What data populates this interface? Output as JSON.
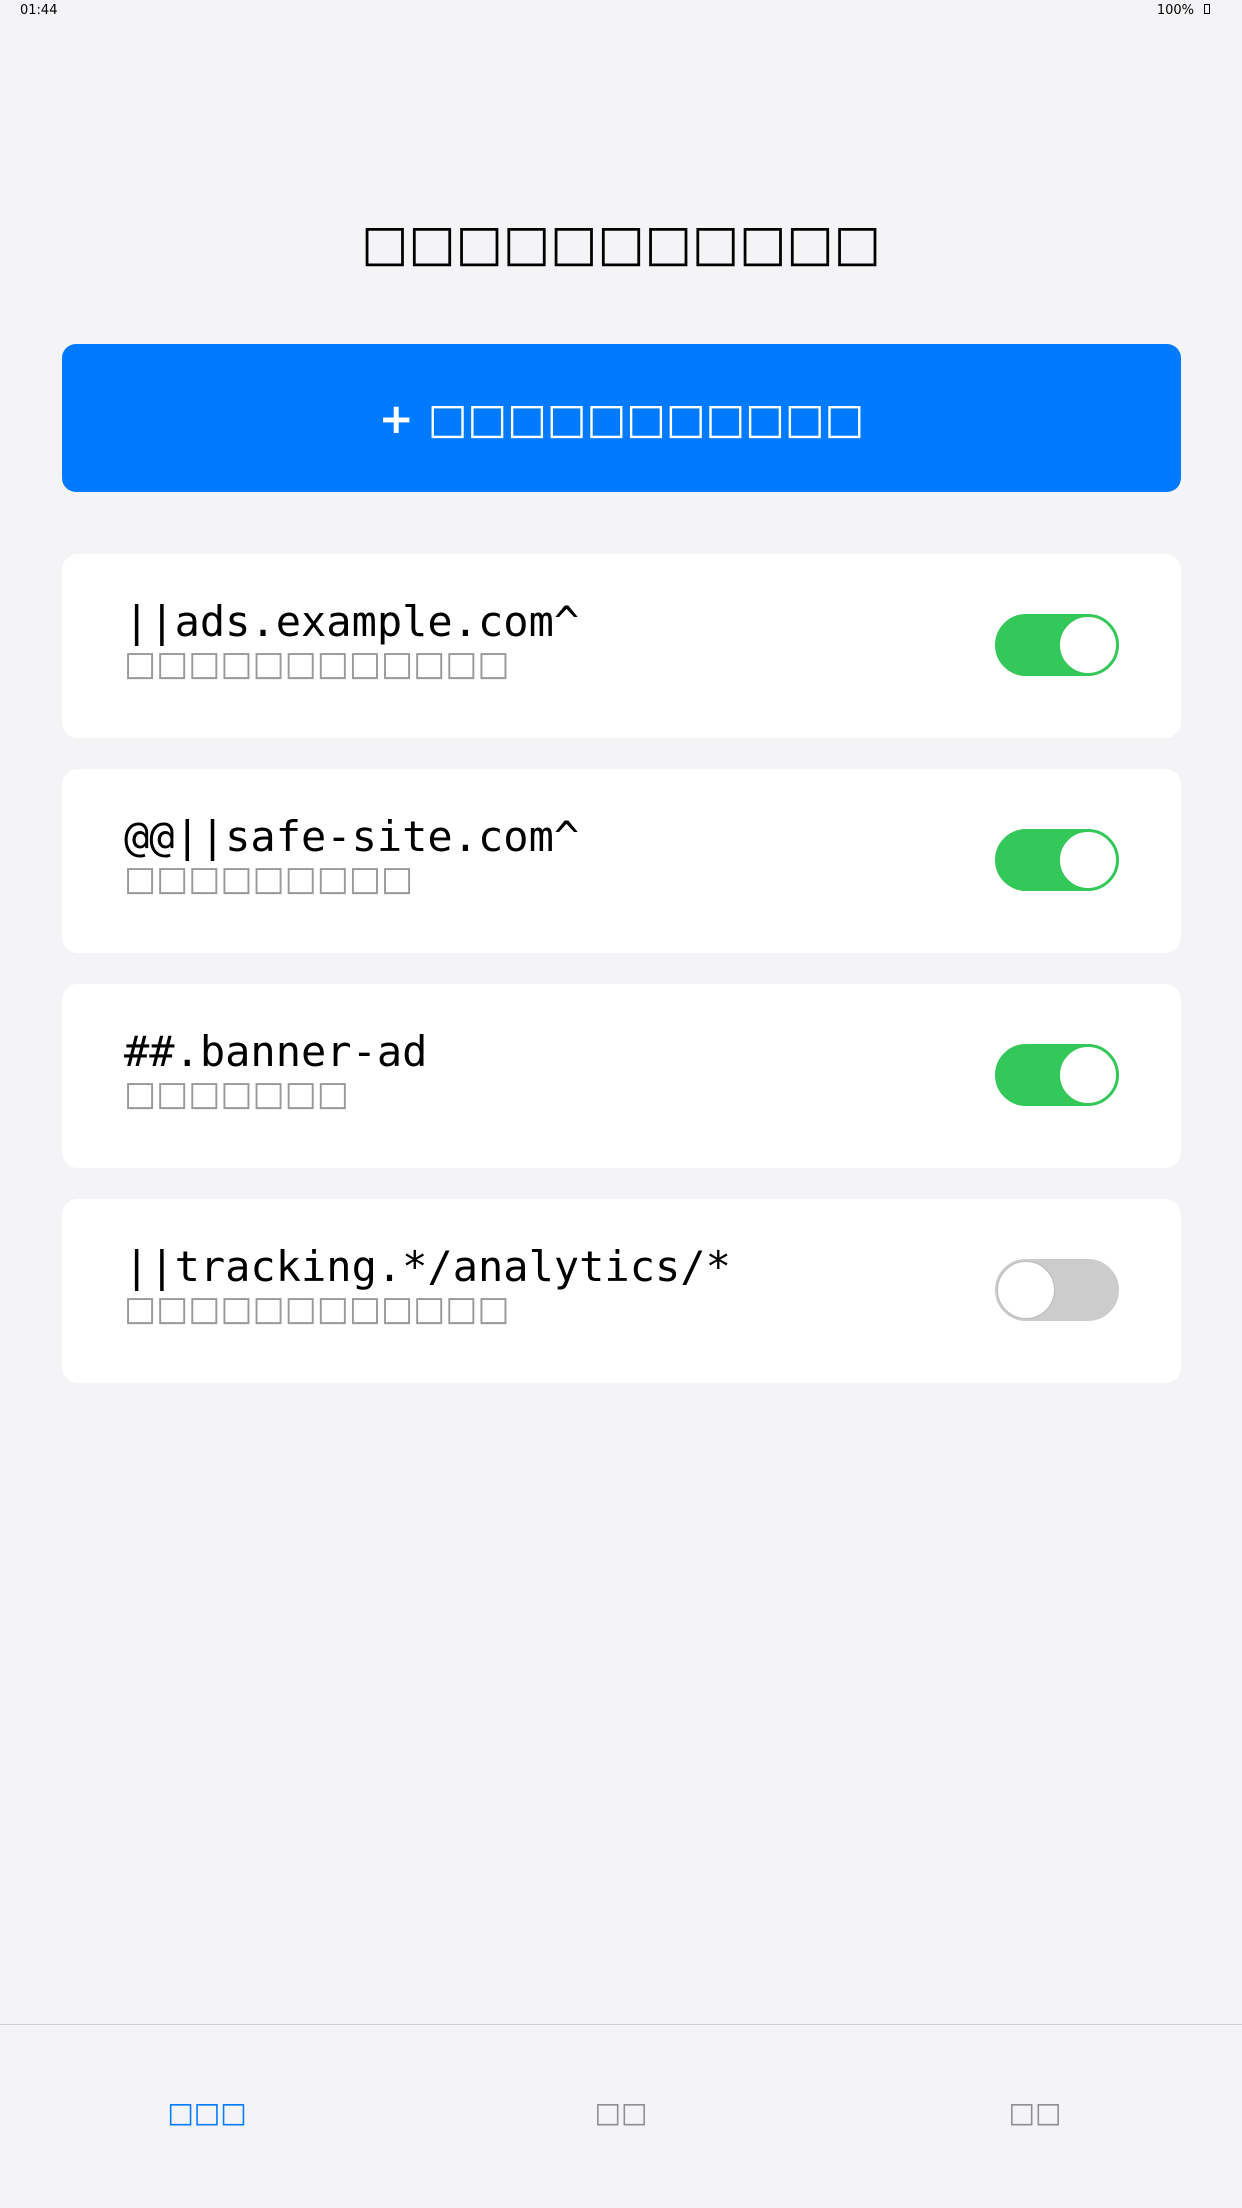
{
  "status_bar": {
    "time": "01:44",
    "battery": "100%"
  },
  "header": {
    "title": "□□□□□□□□□□□"
  },
  "add_button": {
    "plus": "+",
    "label": "□□□□□□□□□□□"
  },
  "rules": [
    {
      "pattern": "||ads.example.com^",
      "description": "□□□□□□□□□□□□",
      "enabled": true
    },
    {
      "pattern": "@@||safe-site.com^",
      "description": "□□□□□□□□□",
      "enabled": true
    },
    {
      "pattern": "##.banner-ad",
      "description": "□□□□□□□",
      "enabled": true
    },
    {
      "pattern": "||tracking.*/analytics/*",
      "description": "□□□□□□□□□□□□",
      "enabled": false
    }
  ],
  "tab_bar": {
    "tabs": [
      {
        "label": "□□□",
        "active": true
      },
      {
        "label": "□□",
        "active": false
      },
      {
        "label": "□□",
        "active": false
      }
    ]
  },
  "colors": {
    "accent": "#007aff",
    "toggle_on": "#34c759",
    "toggle_off": "#cccccc",
    "secondary_text": "#999999"
  }
}
